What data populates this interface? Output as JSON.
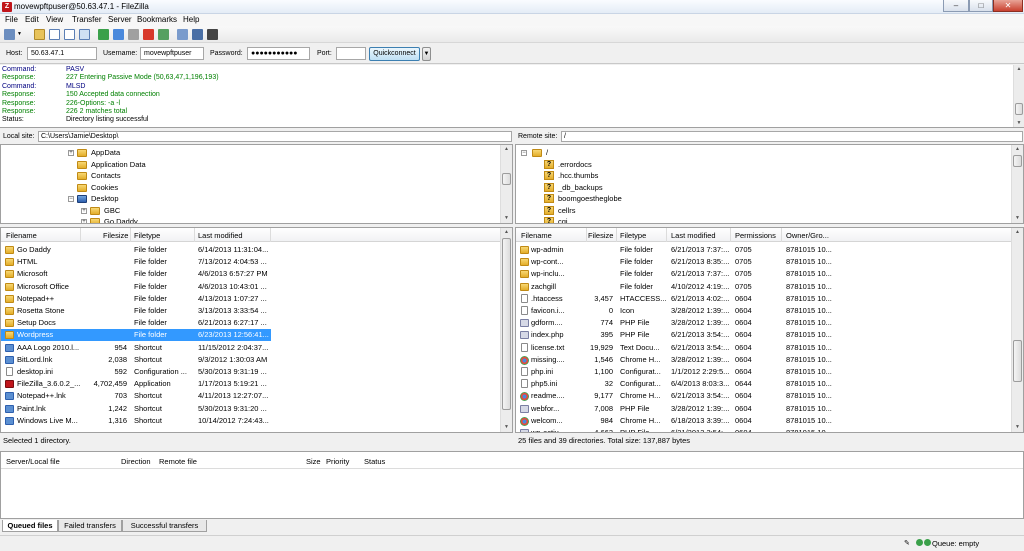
{
  "window": {
    "title": "movewpftpuser@50.63.47.1 - FileZilla",
    "app_icon": "Z"
  },
  "menu": [
    "File",
    "Edit",
    "View",
    "Transfer",
    "Server",
    "Bookmarks",
    "Help"
  ],
  "quickconnect": {
    "host_label": "Host:",
    "host": "50.63.47.1",
    "user_label": "Username:",
    "user": "movewpftpuser",
    "pass_label": "Password:",
    "pass": "●●●●●●●●●●●",
    "port_label": "Port:",
    "port": "",
    "button": "Quickconnect",
    "dropdown": "▼"
  },
  "log": [
    {
      "k": "Command:",
      "v": "PASV",
      "c": "#000080"
    },
    {
      "k": "Response:",
      "v": "227 Entering Passive Mode (50,63,47,1,196,193)",
      "c": "#008000"
    },
    {
      "k": "Command:",
      "v": "MLSD",
      "c": "#000080"
    },
    {
      "k": "Response:",
      "v": "150 Accepted data connection",
      "c": "#008000"
    },
    {
      "k": "Response:",
      "v": "226-Options: -a -l",
      "c": "#008000"
    },
    {
      "k": "Response:",
      "v": "226 2 matches total",
      "c": "#008000"
    },
    {
      "k": "Status:",
      "v": "Directory listing successful",
      "c": "#000000"
    }
  ],
  "local": {
    "site_label": "Local site:",
    "path": "C:\\Users\\Jamie\\Desktop\\",
    "tree": [
      "AppData",
      "Application Data",
      "Contacts",
      "Cookies",
      "Desktop",
      "GBC",
      "Go Daddy"
    ],
    "headers": [
      "Filename",
      "Filesize",
      "Filetype",
      "Last modified"
    ],
    "files": [
      {
        "n": "Go Daddy",
        "s": "",
        "t": "File folder",
        "m": "6/14/2013 11:31:04...",
        "i": "folder-i"
      },
      {
        "n": "HTML",
        "s": "",
        "t": "File folder",
        "m": "7/13/2012 4:04:53 ...",
        "i": "folder-i"
      },
      {
        "n": "Microsoft",
        "s": "",
        "t": "File folder",
        "m": "4/6/2013 6:57:27 PM",
        "i": "folder-i"
      },
      {
        "n": "Microsoft Office",
        "s": "",
        "t": "File folder",
        "m": "4/6/2013 10:43:01 ...",
        "i": "folder-i"
      },
      {
        "n": "Notepad++",
        "s": "",
        "t": "File folder",
        "m": "4/13/2013 1:07:27 ...",
        "i": "folder-i"
      },
      {
        "n": "Rosetta Stone",
        "s": "",
        "t": "File folder",
        "m": "3/13/2013 3:33:54 ...",
        "i": "folder-i"
      },
      {
        "n": "Setup Docs",
        "s": "",
        "t": "File folder",
        "m": "6/21/2013 6:27:17 ...",
        "i": "folder-i"
      },
      {
        "n": "Wordpress",
        "s": "",
        "t": "File folder",
        "m": "6/23/2013 12:56:41...",
        "i": "folder-i",
        "sel": true
      },
      {
        "n": "AAA Logo 2010.l...",
        "s": "954",
        "t": "Shortcut",
        "m": "11/15/2012 2:04:37...",
        "i": "app-i"
      },
      {
        "n": "BitLord.lnk",
        "s": "2,038",
        "t": "Shortcut",
        "m": "9/3/2012 1:30:03 AM",
        "i": "app-i"
      },
      {
        "n": "desktop.ini",
        "s": "592",
        "t": "Configuration ...",
        "m": "5/30/2013 9:31:19 ...",
        "i": "doc-i"
      },
      {
        "n": "FileZilla_3.6.0.2_...",
        "s": "4,702,459",
        "t": "Application",
        "m": "1/17/2013 5:19:21 ...",
        "i": "red-i"
      },
      {
        "n": "Notepad++.lnk",
        "s": "703",
        "t": "Shortcut",
        "m": "4/11/2013 12:27:07...",
        "i": "app-i"
      },
      {
        "n": "Paint.lnk",
        "s": "1,242",
        "t": "Shortcut",
        "m": "5/30/2013 9:31:20 ...",
        "i": "app-i"
      },
      {
        "n": "Windows Live M...",
        "s": "1,316",
        "t": "Shortcut",
        "m": "10/14/2012 7:24:43...",
        "i": "app-i"
      }
    ],
    "status": "Selected 1 directory."
  },
  "remote": {
    "site_label": "Remote site:",
    "path": "/",
    "tree": [
      "/",
      ".errordocs",
      ".hcc.thumbs",
      "_db_backups",
      "boomgoestheglobe",
      "cellrs",
      "cgi"
    ],
    "headers": [
      "Filename",
      "Filesize",
      "Filetype",
      "Last modified",
      "Permissions",
      "Owner/Gro..."
    ],
    "files": [
      {
        "n": "wp-admin",
        "s": "",
        "t": "File folder",
        "m": "6/21/2013 7:37:...",
        "p": "0705",
        "o": "8781015 10...",
        "i": "folder-i"
      },
      {
        "n": "wp-cont...",
        "s": "",
        "t": "File folder",
        "m": "6/21/2013 8:35:...",
        "p": "0705",
        "o": "8781015 10...",
        "i": "folder-i"
      },
      {
        "n": "wp-inclu...",
        "s": "",
        "t": "File folder",
        "m": "6/21/2013 7:37:...",
        "p": "0705",
        "o": "8781015 10...",
        "i": "folder-i"
      },
      {
        "n": "zachgill",
        "s": "",
        "t": "File folder",
        "m": "4/10/2012 4:19:...",
        "p": "0705",
        "o": "8781015 10...",
        "i": "folder-i"
      },
      {
        "n": ".htaccess",
        "s": "3,457",
        "t": "HTACCESS...",
        "m": "6/21/2013 4:02:...",
        "p": "0604",
        "o": "8781015 10...",
        "i": "doc-i"
      },
      {
        "n": "favicon.i...",
        "s": "0",
        "t": "Icon",
        "m": "3/28/2012 1:39:...",
        "p": "0604",
        "o": "8781015 10...",
        "i": "doc-i"
      },
      {
        "n": "gdform....",
        "s": "774",
        "t": "PHP File",
        "m": "3/28/2012 1:39:...",
        "p": "0604",
        "o": "8781015 10...",
        "i": "php-i"
      },
      {
        "n": "index.php",
        "s": "395",
        "t": "PHP File",
        "m": "6/21/2013 3:54:...",
        "p": "0604",
        "o": "8781015 10...",
        "i": "php-i"
      },
      {
        "n": "license.txt",
        "s": "19,929",
        "t": "Text Docu...",
        "m": "6/21/2013 3:54:...",
        "p": "0604",
        "o": "8781015 10...",
        "i": "doc-i"
      },
      {
        "n": "missing....",
        "s": "1,546",
        "t": "Chrome H...",
        "m": "3/28/2012 1:39:...",
        "p": "0604",
        "o": "8781015 10...",
        "i": "chrome-i"
      },
      {
        "n": "php.ini",
        "s": "1,100",
        "t": "Configurat...",
        "m": "1/1/2012 2:29:5...",
        "p": "0604",
        "o": "8781015 10...",
        "i": "doc-i"
      },
      {
        "n": "php5.ini",
        "s": "32",
        "t": "Configurat...",
        "m": "6/4/2013 8:03:3...",
        "p": "0644",
        "o": "8781015 10...",
        "i": "doc-i"
      },
      {
        "n": "readme....",
        "s": "9,177",
        "t": "Chrome H...",
        "m": "6/21/2013 3:54:...",
        "p": "0604",
        "o": "8781015 10...",
        "i": "chrome-i"
      },
      {
        "n": "webfor...",
        "s": "7,008",
        "t": "PHP File",
        "m": "3/28/2012 1:39:...",
        "p": "0604",
        "o": "8781015 10...",
        "i": "php-i"
      },
      {
        "n": "welcom...",
        "s": "984",
        "t": "Chrome H...",
        "m": "6/18/2013 3:39:...",
        "p": "0604",
        "o": "8781015 10...",
        "i": "chrome-i"
      },
      {
        "n": "wp-activ...",
        "s": "4,663",
        "t": "PHP File",
        "m": "6/21/2013 3:54:...",
        "p": "0604",
        "o": "8781015 10...",
        "i": "php-i"
      }
    ],
    "status": "25 files and 39 directories. Total size: 137,887 bytes"
  },
  "queue": {
    "headers": [
      "Server/Local file",
      "Direction",
      "Remote file",
      "Size",
      "Priority",
      "Status"
    ]
  },
  "tabs": [
    "Queued files",
    "Failed transfers",
    "Successful transfers"
  ],
  "statusbar": {
    "queue": "Queue: empty"
  }
}
